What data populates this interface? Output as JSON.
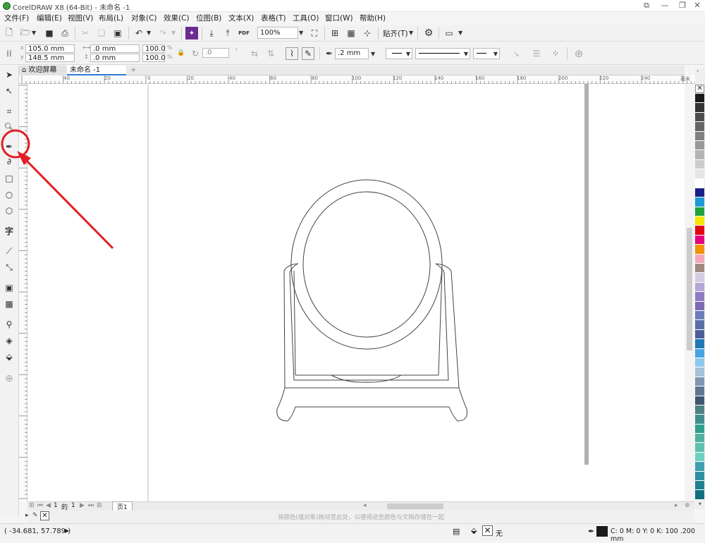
{
  "titlebar": {
    "title": "CorelDRAW X8 (64-Bit) - 未命名 -1"
  },
  "menu": [
    "文件(F)",
    "编辑(E)",
    "视图(V)",
    "布局(L)",
    "对象(C)",
    "效果(C)",
    "位图(B)",
    "文本(X)",
    "表格(T)",
    "工具(O)",
    "窗口(W)",
    "帮助(H)"
  ],
  "toolbar": {
    "zoom": "100%",
    "snap_label": "贴齐(T)",
    "pdf_label": "PDF"
  },
  "propbar": {
    "x": "105.0 mm",
    "y": "148.5 mm",
    "w": ".0 mm",
    "h": ".0 mm",
    "scale_x": "100.0",
    "scale_y": "100.0",
    "pct": "%",
    "angle": ".0",
    "outline_width": ".2 mm"
  },
  "tabs": {
    "welcome": "欢迎屏幕",
    "doc": "未命名 -1"
  },
  "ruler": {
    "h_labels": [
      "40",
      "20",
      "0",
      "20",
      "40",
      "60",
      "80",
      "100",
      "120",
      "140",
      "160",
      "180",
      "200",
      "220",
      "240"
    ],
    "unit": "毫米",
    "v_labels": [
      "280",
      "260",
      "240",
      "220",
      "200",
      "180",
      "160",
      "140",
      "120",
      "100",
      "80"
    ]
  },
  "page_nav": {
    "current": "1",
    "of": "的",
    "total": "1",
    "page_tab": "页1"
  },
  "hint": "将颜色(或对象)拖动至此处，以便将这些颜色与文档存储在一起",
  "status": {
    "coords": "( -34.681, 57.789 )",
    "fill_label": "无",
    "outline_info": "C: 0 M: 0 Y: 0 K: 100  .200 mm"
  },
  "palette": [
    "#1a1a1a",
    "#333333",
    "#4d4d4d",
    "#666666",
    "#808080",
    "#999999",
    "#b3b3b3",
    "#cccccc",
    "#e6e6e6",
    "#ffffff",
    "#1b1f8a",
    "#1e9ad6",
    "#22a33a",
    "#f5e400",
    "#e30613",
    "#e6007e",
    "#f39200",
    "#f4a9b8",
    "#a1887f",
    "#d3cce3",
    "#b3a8d6",
    "#8e7cc3",
    "#7b6bb3",
    "#6a7fb8",
    "#5a6fa8",
    "#4a5f98",
    "#1f78b4",
    "#4aa3df",
    "#8cc8ec",
    "#a6c1d9",
    "#7f97b2",
    "#5f7791",
    "#3f576f",
    "#4f7f7f",
    "#3f8f8f",
    "#2f9f8f",
    "#50b0a0",
    "#60c0b0",
    "#70d0c0",
    "#40a0b0",
    "#3090a0",
    "#208090",
    "#107080"
  ],
  "accent": "#e31e24"
}
